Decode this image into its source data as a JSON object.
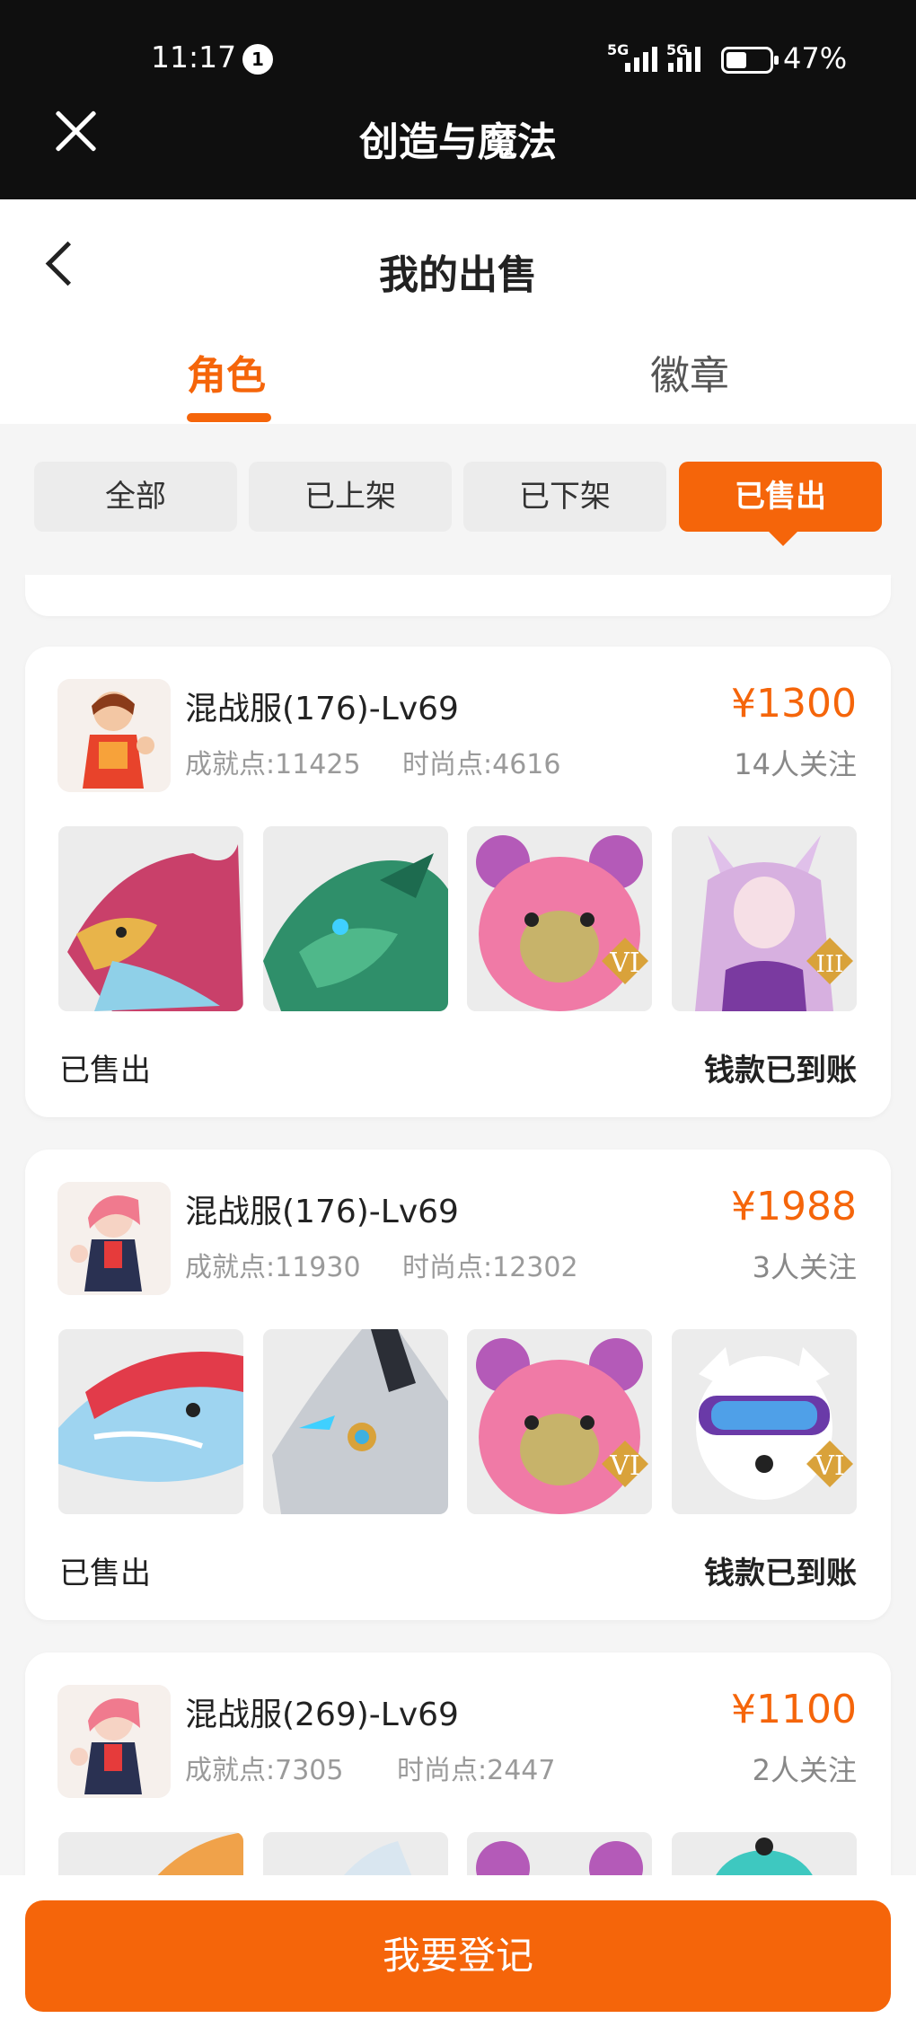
{
  "status_bar": {
    "time": "11:17",
    "notification_count": "1",
    "network_1": "5G",
    "network_2": "5G",
    "battery_percent": "47%",
    "battery_level": 0.47
  },
  "app_bar": {
    "title": "创造与魔法",
    "close_icon": "close-icon"
  },
  "header": {
    "back_icon": "chevron-left-icon",
    "title": "我的出售"
  },
  "tabs": [
    {
      "label": "角色",
      "active": true
    },
    {
      "label": "徽章",
      "active": false
    }
  ],
  "filters": [
    {
      "label": "全部",
      "active": false
    },
    {
      "label": "已上架",
      "active": false
    },
    {
      "label": "已下架",
      "active": false
    },
    {
      "label": "已售出",
      "active": true
    }
  ],
  "listings": [
    {
      "server": "混战服(176)-Lv69",
      "achievement": "成就点:11425",
      "fashion": "时尚点:4616",
      "price": "¥1300",
      "followers": "14人关注",
      "items": [
        {
          "badge": ""
        },
        {
          "badge": ""
        },
        {
          "badge": "VI"
        },
        {
          "badge": "III"
        }
      ],
      "status": "已售出",
      "payment": "钱款已到账"
    },
    {
      "server": "混战服(176)-Lv69",
      "achievement": "成就点:11930",
      "fashion": "时尚点:12302",
      "price": "¥1988",
      "followers": "3人关注",
      "items": [
        {
          "badge": ""
        },
        {
          "badge": ""
        },
        {
          "badge": "VI"
        },
        {
          "badge": "VI"
        }
      ],
      "status": "已售出",
      "payment": "钱款已到账"
    },
    {
      "server": "混战服(269)-Lv69",
      "achievement": "成就点:7305",
      "fashion": "时尚点:2447",
      "price": "¥1100",
      "followers": "2人关注"
    }
  ],
  "bottom_button": {
    "label": "我要登记"
  },
  "colors": {
    "accent": "#f5650a",
    "appbar_bg": "#0f0f0f",
    "page_bg": "#f5f5f5"
  }
}
